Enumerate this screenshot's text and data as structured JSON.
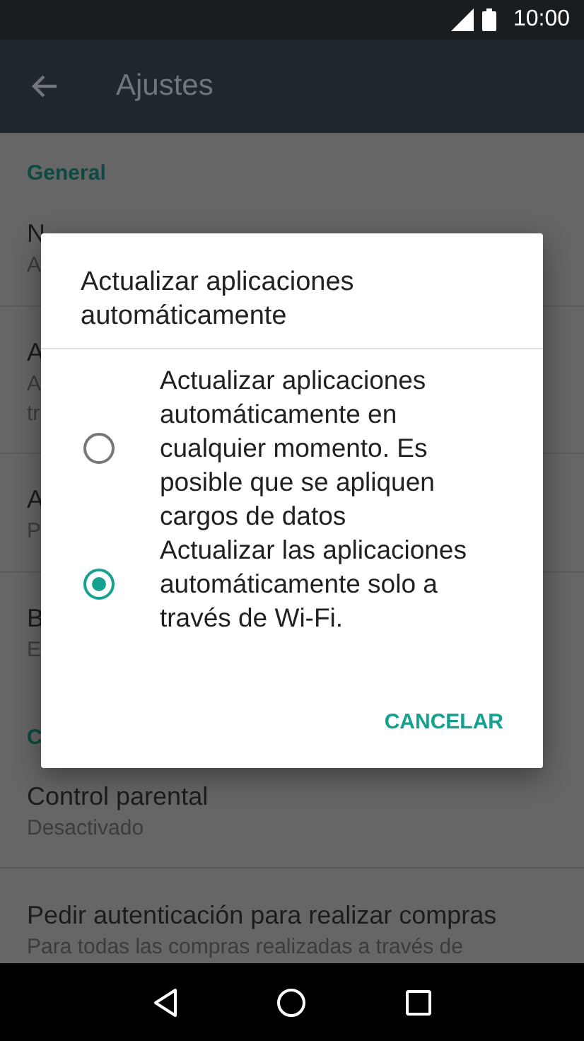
{
  "status_bar": {
    "time": "10:00"
  },
  "app_bar": {
    "title": "Ajustes"
  },
  "settings": [
    {
      "kind": "header",
      "title": "General"
    },
    {
      "kind": "item",
      "title": "N",
      "subtitle": [
        "A"
      ]
    },
    {
      "kind": "item",
      "title": "A",
      "subtitle": [
        "A",
        "tr"
      ]
    },
    {
      "kind": "item",
      "title": "A",
      "subtitle": [
        "P"
      ]
    },
    {
      "kind": "item",
      "title": "B",
      "subtitle": [
        "E"
      ]
    },
    {
      "kind": "header",
      "title": "C"
    },
    {
      "kind": "item",
      "title": "Control parental",
      "subtitle": [
        "Desactivado"
      ]
    },
    {
      "kind": "item",
      "title": "Pedir autenticación para realizar compras",
      "subtitle": [
        "Para todas las compras realizadas a través de"
      ]
    }
  ],
  "dialog": {
    "title": "Actualizar aplicaciones automáticamente",
    "options": [
      {
        "label": "Actualizar aplicaciones automáticamente en cualquier momento. Es posible que se apliquen cargos de datos",
        "selected": false
      },
      {
        "label": "Actualizar las aplicaciones automáticamente solo a través de Wi-Fi.",
        "selected": true
      }
    ],
    "buttons": [
      "CANCELAR"
    ]
  }
}
